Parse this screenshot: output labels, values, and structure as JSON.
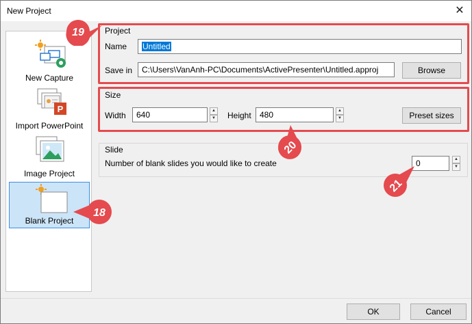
{
  "window": {
    "title": "New Project",
    "close_icon": "close-icon"
  },
  "sidebar": {
    "items": [
      {
        "label": "New Capture",
        "icon": "new-capture-icon"
      },
      {
        "label": "Import PowerPoint",
        "icon": "import-powerpoint-icon"
      },
      {
        "label": "Image Project",
        "icon": "image-project-icon"
      },
      {
        "label": "Blank Project",
        "icon": "blank-project-icon",
        "selected": true
      }
    ]
  },
  "project": {
    "title": "Project",
    "name_label": "Name",
    "name_value": "Untitled",
    "save_in_label": "Save in",
    "save_in_value": "C:\\Users\\VanAnh-PC\\Documents\\ActivePresenter\\Untitled.approj",
    "browse_label": "Browse"
  },
  "size": {
    "title": "Size",
    "width_label": "Width",
    "width_value": "640",
    "height_label": "Height",
    "height_value": "480",
    "preset_label": "Preset sizes"
  },
  "slide": {
    "title": "Slide",
    "blank_slides_label": "Number of blank slides you would like to create",
    "blank_slides_value": "0"
  },
  "callouts": [
    "19",
    "20",
    "21",
    "18"
  ],
  "footer": {
    "ok_label": "OK",
    "cancel_label": "Cancel"
  },
  "colors": {
    "accent": "#0078d7",
    "callout": "#e44a4e",
    "selected_bg": "#cce4f7"
  }
}
